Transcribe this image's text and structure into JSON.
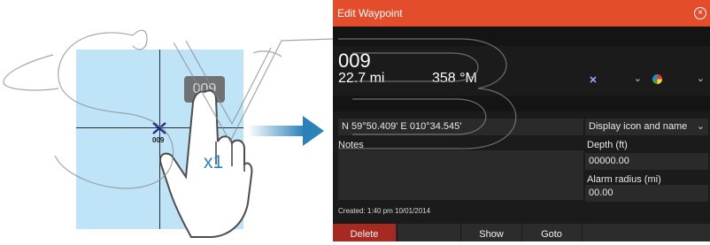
{
  "illustration": {
    "waypoint_label": "009",
    "tap_badge": "009",
    "tap_count": "x1",
    "accent_color": "#2a82b8",
    "map_color": "#bfe3f7"
  },
  "dialog": {
    "title": "Edit Waypoint",
    "close_icon": "×",
    "name": "009",
    "distance": "22.7 mi",
    "bearing": "358 °M",
    "position": "N 59°50.409'   E 010°34.545'",
    "display_mode": "Display icon and name",
    "notes_label": "Notes",
    "notes_value": "",
    "depth_label": "Depth (ft)",
    "depth_value": "00000.00",
    "alarm_label": "Alarm radius (mi)",
    "alarm_value": "00.00",
    "created": "Created: 1:40 pm  10/01/2014",
    "buttons": {
      "delete": "Delete",
      "show": "Show",
      "goto": "Goto"
    },
    "colors": {
      "titlebar": "#e34d2b",
      "delete": "#a62a22",
      "background": "#1b1b1b"
    }
  },
  "icons": {
    "dropdown": "⌄",
    "waypoint_symbol": "waypoint-cross-icon",
    "color_wheel": "color-wheel-icon"
  }
}
